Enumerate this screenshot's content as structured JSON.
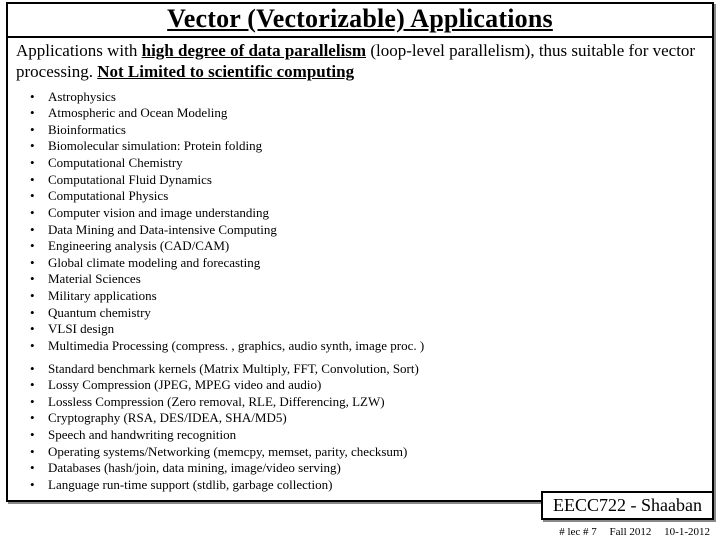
{
  "title": "Vector (Vectorizable) Applications",
  "subtitle": {
    "t1": "Applications with ",
    "t2": "high degree of data parallelism",
    "t3": " (loop-level parallelism), thus suitable for vector processing.  ",
    "t4": "Not Limited to scientific computing"
  },
  "list1": [
    "Astrophysics",
    "Atmospheric and Ocean Modeling",
    "Bioinformatics",
    "Biomolecular simulation: Protein folding",
    "Computational Chemistry",
    "Computational Fluid Dynamics",
    "Computational Physics",
    "Computer vision and image understanding",
    "Data Mining and Data-intensive Computing",
    "Engineering analysis (CAD/CAM)",
    "Global climate modeling and forecasting",
    "Material Sciences",
    "Military applications",
    "Quantum chemistry",
    "VLSI design",
    "Multimedia Processing (compress. , graphics, audio synth, image proc. )"
  ],
  "list2": [
    "Standard benchmark kernels (Matrix Multiply, FFT, Convolution, Sort)",
    "Lossy Compression (JPEG, MPEG video and audio)",
    "Lossless Compression (Zero removal, RLE, Differencing, LZW)",
    "Cryptography (RSA, DES/IDEA, SHA/MD5)",
    "Speech and handwriting recognition",
    "Operating systems/Networking (memcpy, memset, parity, checksum)",
    "Databases (hash/join, data mining, image/video serving)",
    "Language run-time support (stdlib, garbage collection)"
  ],
  "footer": {
    "course": "EECC722 - Shaaban",
    "lec": "#  lec # 7",
    "term": "Fall 2012",
    "date": "10-1-2012"
  }
}
